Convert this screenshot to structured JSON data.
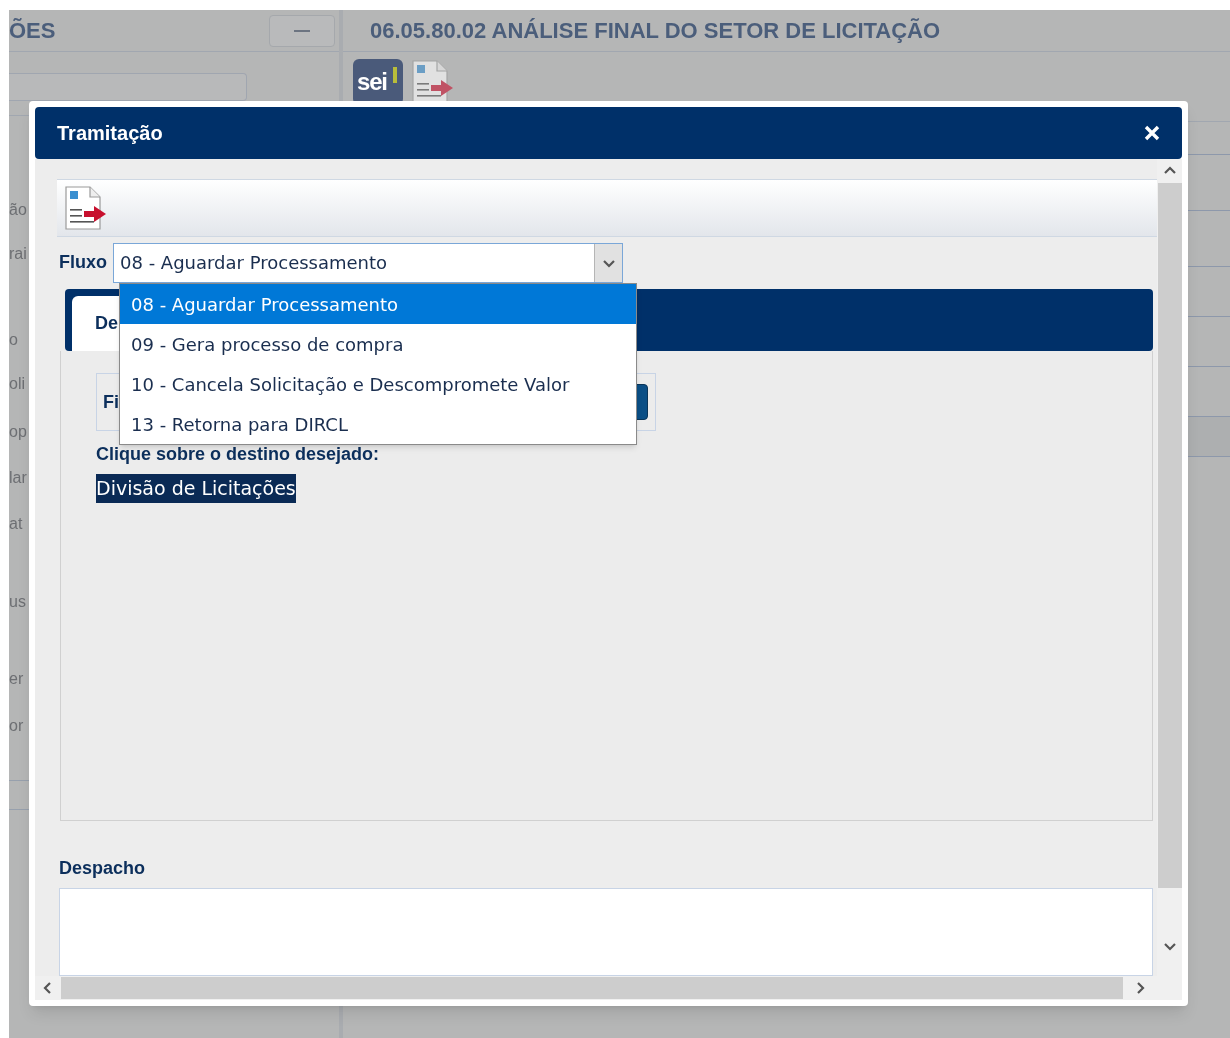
{
  "background": {
    "left_panel": {
      "title": "ÕES",
      "fragments": [
        "ão",
        "rai",
        "o",
        "oli",
        "op",
        "lar",
        "at",
        "us",
        "er",
        "or"
      ]
    },
    "right_panel": {
      "title": "06.05.80.02 ANÁLISE FINAL DO SETOR DE LICITAÇÃO",
      "logo_text": "sei"
    }
  },
  "dialog": {
    "title": "Tramitação",
    "flow": {
      "label": "Fluxo",
      "value": "08 - Aguardar Processamento",
      "expanded": true,
      "options": [
        {
          "label": "08 - Aguardar Processamento",
          "selected": true
        },
        {
          "label": "09 - Gera processo de compra",
          "selected": false
        },
        {
          "label": "10 - Cancela Solicitação e Descompromete Valor",
          "selected": false
        },
        {
          "label": "13 - Retorna para DIRCL",
          "selected": false
        }
      ]
    },
    "tabs": [
      {
        "label": "De",
        "selected": true
      }
    ],
    "fieldset_label": "Fi",
    "destination": {
      "prompt": "Clique sobre o destino desejado:",
      "items": [
        {
          "label": "Divisão de Licitações",
          "selected": true
        }
      ]
    },
    "dispatch": {
      "label": "Despacho"
    }
  }
}
